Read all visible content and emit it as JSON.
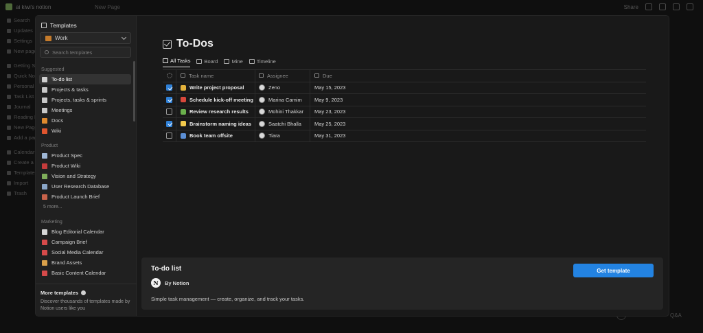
{
  "app": {
    "workspace": "ai kiwi's notion",
    "page_title": "New Page",
    "topbar": {
      "edited": "",
      "share": "Share"
    },
    "sidebar_items": [
      "Search",
      "Updates",
      "Settings",
      "New page",
      "Getting Started",
      "Quick Note",
      "Personal Home",
      "Task List",
      "Journal",
      "Reading List",
      "New Page",
      "Add a page",
      "Calendar",
      "Create a teamspace",
      "Templates",
      "Import",
      "Trash"
    ],
    "help": {
      "qa": "Q&A"
    }
  },
  "templates_sidebar": {
    "title": "Templates",
    "category": "Work",
    "search_placeholder": "Search templates",
    "sections": [
      {
        "label": "Suggested",
        "items": [
          {
            "label": "To-do list",
            "icon": "checkbox-icon",
            "color": "#cfcfcf",
            "selected": true
          },
          {
            "label": "Projects & tasks",
            "icon": "target-icon",
            "color": "#c8c8c8"
          },
          {
            "label": "Projects, tasks & sprints",
            "icon": "runner-icon",
            "color": "#c8c8c8"
          },
          {
            "label": "Meetings",
            "icon": "calendar-icon",
            "color": "#c8c8c8"
          },
          {
            "label": "Docs",
            "icon": "doc-icon",
            "color": "#e08a2e"
          },
          {
            "label": "Wiki",
            "icon": "wiki-icon",
            "color": "#e0552e"
          }
        ]
      },
      {
        "label": "Product",
        "items": [
          {
            "label": "Product Spec",
            "icon": "spec-icon",
            "color": "#9fb7d6"
          },
          {
            "label": "Product Wiki",
            "icon": "wiki-icon",
            "color": "#c43b3b"
          },
          {
            "label": "Vision and Strategy",
            "icon": "mountain-icon",
            "color": "#7fae5a"
          },
          {
            "label": "User Research Database",
            "icon": "microscope-icon",
            "color": "#8aa6c8"
          },
          {
            "label": "Product Launch Brief",
            "icon": "rocket-icon",
            "color": "#c8624a"
          }
        ],
        "more": "5 more..."
      },
      {
        "label": "Marketing",
        "items": [
          {
            "label": "Blog Editorial Calendar",
            "icon": "pen-icon",
            "color": "#d6d6d6"
          },
          {
            "label": "Campaign Brief",
            "icon": "calendar-icon",
            "color": "#d64a4a"
          },
          {
            "label": "Social Media Calendar",
            "icon": "calendar-icon",
            "color": "#d64a4a"
          },
          {
            "label": "Brand Assets",
            "icon": "palette-icon",
            "color": "#d9a04a"
          },
          {
            "label": "Basic Content Calendar",
            "icon": "calendar-icon",
            "color": "#d64a4a"
          }
        ]
      }
    ],
    "footer": {
      "title": "More templates",
      "desc": "Discover thousands of templates made by Notion users like you"
    }
  },
  "preview": {
    "title": "To-Dos",
    "views": [
      {
        "label": "All Tasks",
        "active": true
      },
      {
        "label": "Board"
      },
      {
        "label": "Mine"
      },
      {
        "label": "Timeline"
      }
    ],
    "columns": {
      "task": "Task name",
      "assignee": "Assignee",
      "due": "Due"
    },
    "rows": [
      {
        "done": true,
        "emoji_color": "#e3b23c",
        "task": "Write project proposal",
        "assignee": "Zeno",
        "due": "May 15, 2023"
      },
      {
        "done": true,
        "emoji_color": "#d9483b",
        "task": "Schedule kick-off meeting",
        "assignee": "Marina Camim",
        "due": "May 9, 2023"
      },
      {
        "done": false,
        "emoji_color": "#6ab04c",
        "task": "Review research results",
        "assignee": "Mohini Thakkar",
        "due": "May 23, 2023"
      },
      {
        "done": true,
        "emoji_color": "#f2c94c",
        "task": "Brainstorm naming ideas",
        "assignee": "Saatchi Bhalla",
        "due": "May 25, 2023"
      },
      {
        "done": false,
        "emoji_color": "#5b8fd6",
        "task": "Book team offsite",
        "assignee": "Tiara",
        "due": "May 31, 2023"
      }
    ]
  },
  "detail": {
    "title": "To-do list",
    "by": "By Notion",
    "logo_letter": "N",
    "description": "Simple task management — create, organize, and track your tasks.",
    "button": "Get template"
  }
}
